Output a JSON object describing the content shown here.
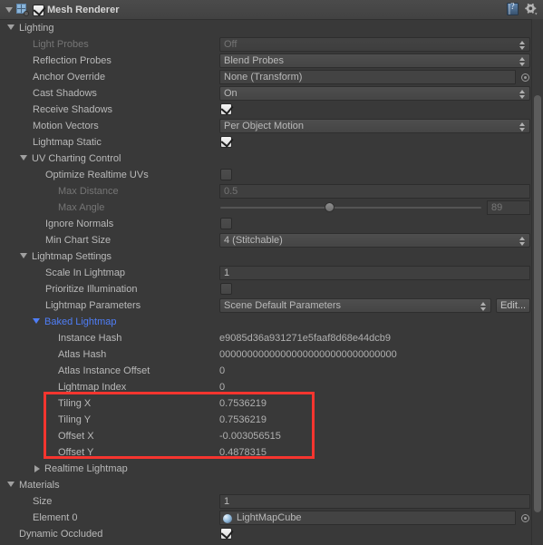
{
  "header": {
    "title": "Mesh Renderer",
    "enabled_checkbox": true,
    "foldout_expanded": true,
    "icon": "mesh-renderer-icon",
    "help_icon": "help-book-icon",
    "settings_icon": "gear-icon"
  },
  "sections": {
    "lighting": "Lighting",
    "uv_charting_control": "UV Charting Control",
    "lightmap_settings": "Lightmap Settings",
    "baked_lightmap": "Baked Lightmap",
    "realtime_lightmap": "Realtime Lightmap",
    "materials": "Materials"
  },
  "rows": {
    "light_probes": {
      "label": "Light Probes",
      "value": "Off"
    },
    "reflection_probes": {
      "label": "Reflection Probes",
      "value": "Blend Probes"
    },
    "anchor_override": {
      "label": "Anchor Override",
      "value": "None (Transform)"
    },
    "cast_shadows": {
      "label": "Cast Shadows",
      "value": "On"
    },
    "receive_shadows": {
      "label": "Receive Shadows",
      "value": "checked"
    },
    "motion_vectors": {
      "label": "Motion Vectors",
      "value": "Per Object Motion"
    },
    "lightmap_static": {
      "label": "Lightmap Static",
      "value": "checked"
    },
    "optimize_realtime_uvs": {
      "label": "Optimize Realtime UVs",
      "value": "unchecked"
    },
    "max_distance": {
      "label": "Max Distance",
      "value": "0.5"
    },
    "max_angle": {
      "label": "Max Angle",
      "value": "89",
      "slider_percent": 42
    },
    "ignore_normals": {
      "label": "Ignore Normals",
      "value": "unchecked"
    },
    "min_chart_size": {
      "label": "Min Chart Size",
      "value": "4 (Stitchable)"
    },
    "scale_in_lightmap": {
      "label": "Scale In Lightmap",
      "value": "1"
    },
    "prioritize_illumination": {
      "label": "Prioritize Illumination",
      "value": "unchecked"
    },
    "lightmap_parameters": {
      "label": "Lightmap Parameters",
      "value": "Scene Default Parameters",
      "button": "Edit..."
    },
    "instance_hash": {
      "label": "Instance Hash",
      "value": "e9085d36a931271e5faaf8d68e44dcb9"
    },
    "atlas_hash": {
      "label": "Atlas Hash",
      "value": "00000000000000000000000000000000"
    },
    "atlas_instance_offset": {
      "label": "Atlas Instance Offset",
      "value": "0"
    },
    "lightmap_index": {
      "label": "Lightmap Index",
      "value": "0"
    },
    "tiling_x": {
      "label": "Tiling X",
      "value": "0.7536219"
    },
    "tiling_y": {
      "label": "Tiling Y",
      "value": "0.7536219"
    },
    "offset_x": {
      "label": "Offset X",
      "value": "-0.003056515"
    },
    "offset_y": {
      "label": "Offset Y",
      "value": "0.4878315"
    },
    "size": {
      "label": "Size",
      "value": "1"
    },
    "element_0": {
      "label": "Element 0",
      "value": "LightMapCube"
    },
    "dynamic_occluded": {
      "label": "Dynamic Occluded",
      "value": "checked"
    }
  },
  "annotation": {
    "color": "#f5352f",
    "highlights": [
      "Tiling X",
      "Tiling Y",
      "Offset X",
      "Offset Y"
    ]
  },
  "colors": {
    "background": "#393939",
    "text": "#b9b9b9",
    "text_dim": "#757575",
    "accent_blue": "#4f7ef7",
    "annotation_red": "#f5352f"
  }
}
